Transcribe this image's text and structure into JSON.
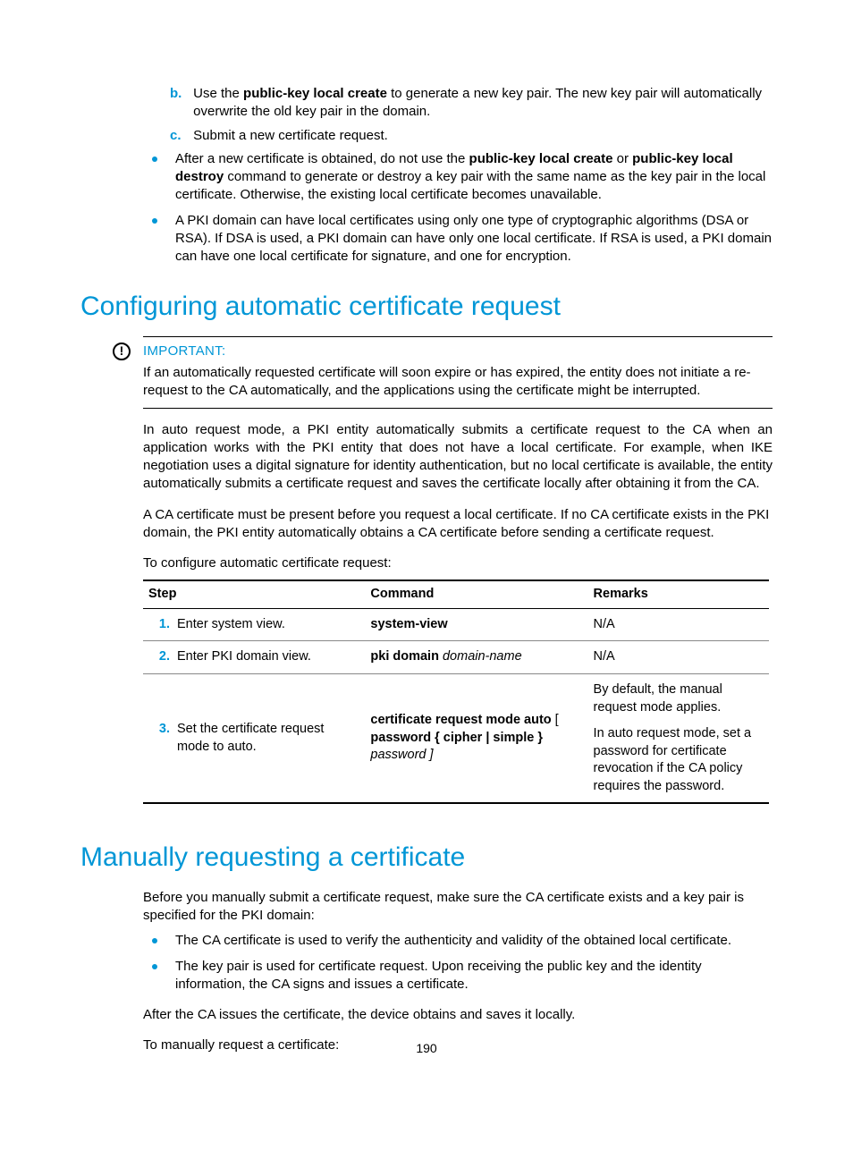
{
  "top_sublist": [
    {
      "marker": "b.",
      "pre": "Use the ",
      "bold": "public-key local create",
      "post": " to generate a new key pair. The new key pair will automatically overwrite the old key pair in the domain."
    },
    {
      "marker": "c.",
      "pre": "Submit a new certificate request.",
      "bold": "",
      "post": ""
    }
  ],
  "top_bullets": {
    "b1_pre": "After a new certificate is obtained, do not use the ",
    "b1_b1": "public-key local create",
    "b1_mid": " or ",
    "b1_b2": "public-key local destroy",
    "b1_post": " command to generate or destroy a key pair with the same name as the key pair in the local certificate. Otherwise, the existing local certificate becomes unavailable.",
    "b2": "A PKI domain can have local certificates using only one type of cryptographic algorithms (DSA or RSA). If DSA is used, a PKI domain can have only one local certificate. If RSA is used, a PKI domain can have one local certificate for signature, and one for encryption."
  },
  "section1_title": "Configuring automatic certificate request",
  "important_label": "IMPORTANT:",
  "important_text": "If an automatically requested certificate will soon expire or has expired, the entity does not initiate a re-request to the CA automatically, and the applications using the certificate might be interrupted.",
  "s1_p1": "In auto request mode, a PKI entity automatically submits a certificate request to the CA when an application works with the PKI entity that does not have a local certificate. For example, when IKE negotiation uses a digital signature for identity authentication, but no local certificate is available, the entity automatically submits a certificate request and saves the certificate locally after obtaining it from the CA.",
  "s1_p2": "A CA certificate must be present before you request a local certificate. If no CA certificate exists in the PKI domain, the PKI entity automatically obtains a CA certificate before sending a certificate request.",
  "s1_p3": "To configure automatic certificate request:",
  "table": {
    "headers": {
      "step": "Step",
      "command": "Command",
      "remarks": "Remarks"
    },
    "rows": [
      {
        "num": "1.",
        "step": "Enter system view.",
        "cmd_bold": "system-view",
        "cmd_ital": "",
        "cmd_tail_bold": "",
        "cmd_tail_ital": "",
        "remarks_a": "N/A",
        "remarks_b": ""
      },
      {
        "num": "2.",
        "step": "Enter PKI domain view.",
        "cmd_bold": "pki domain",
        "cmd_ital": " domain-name",
        "cmd_tail_bold": "",
        "cmd_tail_ital": "",
        "remarks_a": "N/A",
        "remarks_b": ""
      },
      {
        "num": "3.",
        "step": "Set the certificate request mode to auto.",
        "cmd_bold": "certificate request mode auto",
        "cmd_ital": " [ ",
        "cmd_tail_bold": "password { cipher | simple }",
        "cmd_tail_ital": " password ]",
        "remarks_a": "By default, the manual request mode applies.",
        "remarks_b": "In auto request mode, set a password for certificate revocation if the CA policy requires the password."
      }
    ]
  },
  "section2_title": "Manually requesting a certificate",
  "s2_p1": "Before you manually submit a certificate request, make sure the CA certificate exists and a key pair is specified for the PKI domain:",
  "s2_bullets": [
    "The CA certificate is used to verify the authenticity and validity of the obtained local certificate.",
    "The key pair is used for certificate request. Upon receiving the public key and the identity information, the CA signs and issues a certificate."
  ],
  "s2_p2": "After the CA issues the certificate, the device obtains and saves it locally.",
  "s2_p3": "To manually request a certificate:",
  "page_number": "190"
}
